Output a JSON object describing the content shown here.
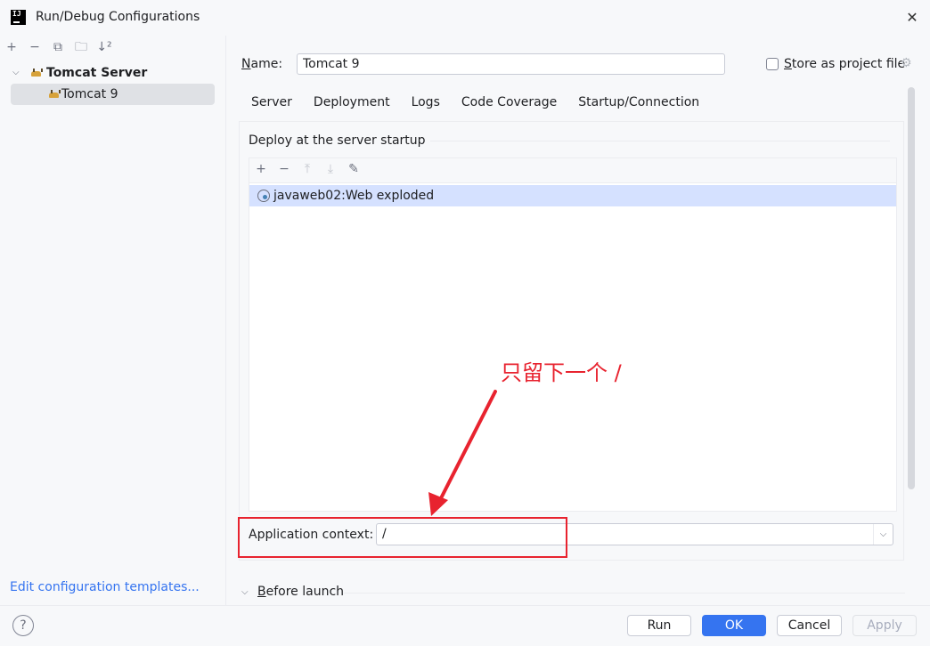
{
  "window": {
    "title": "Run/Debug Configurations",
    "app_logo": "IJ"
  },
  "left": {
    "toolbar": [
      "+",
      "−",
      "⧉",
      "🗀",
      "↓²"
    ],
    "tree": {
      "group_label": "Tomcat Server",
      "child_label": "Tomcat 9"
    },
    "edit_templates": "Edit configuration templates..."
  },
  "name": {
    "label_prefix": "N",
    "label_rest": "ame:",
    "value": "Tomcat 9"
  },
  "store": {
    "label_prefix": "S",
    "label_rest": "tore as project file",
    "checked": false
  },
  "tabs": [
    "Server",
    "Deployment",
    "Logs",
    "Code Coverage",
    "Startup/Connection"
  ],
  "active_tab": "Deployment",
  "deploy": {
    "section_title": "Deploy at the server startup",
    "artifact": "javaweb02:Web exploded"
  },
  "context": {
    "label": "Application context:",
    "value": "/"
  },
  "before_launch": {
    "label_prefix": "B",
    "label_rest": "efore launch"
  },
  "footer": {
    "help": "?",
    "run": "Run",
    "ok": "OK",
    "cancel": "Cancel",
    "apply": "Apply"
  },
  "annotation": {
    "text": "只留下一个 /",
    "color": "#e8232f"
  },
  "colors": {
    "accent": "#3574f0",
    "selection": "#d5e1ff",
    "annotation": "#e8232f"
  }
}
